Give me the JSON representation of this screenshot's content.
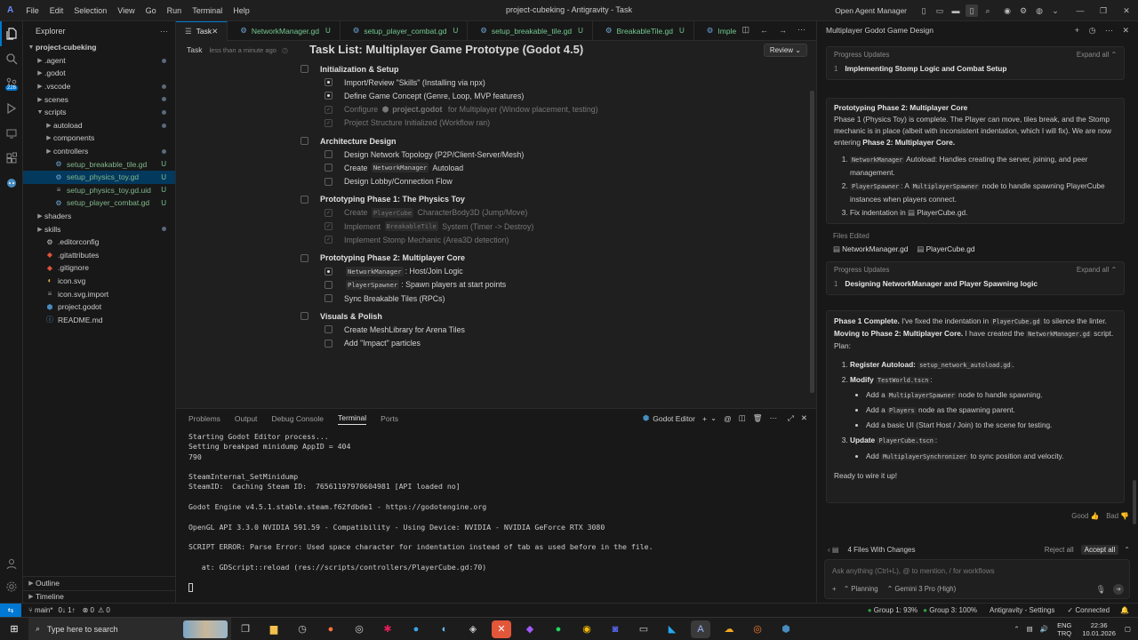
{
  "titlebar": {
    "menus": [
      "File",
      "Edit",
      "Selection",
      "View",
      "Go",
      "Run",
      "Terminal",
      "Help"
    ],
    "title": "project-cubeking - Antigravity - Task",
    "open_agent_manager": "Open Agent Manager"
  },
  "sidebar": {
    "title": "Explorer",
    "root": "project-cubeking",
    "items": [
      {
        "label": ".agent",
        "type": "folder",
        "indent": 1,
        "dot": true
      },
      {
        "label": ".godot",
        "type": "folder",
        "indent": 1,
        "dot": false
      },
      {
        "label": ".vscode",
        "type": "folder",
        "indent": 1,
        "dot": true
      },
      {
        "label": "scenes",
        "type": "folder",
        "indent": 1,
        "dot": true
      },
      {
        "label": "scripts",
        "type": "folder-open",
        "indent": 1,
        "dot": true
      },
      {
        "label": "autoload",
        "type": "folder",
        "indent": 2,
        "dot": true
      },
      {
        "label": "components",
        "type": "folder",
        "indent": 2,
        "dot": false
      },
      {
        "label": "controllers",
        "type": "folder",
        "indent": 2,
        "dot": true
      },
      {
        "label": "setup_breakable_tile.gd",
        "type": "file-gd",
        "indent": 2,
        "status": "U"
      },
      {
        "label": "setup_physics_toy.gd",
        "type": "file-gd",
        "indent": 2,
        "status": "U",
        "selected": true
      },
      {
        "label": "setup_physics_toy.gd.uid",
        "type": "file-uid",
        "indent": 2,
        "status": "U"
      },
      {
        "label": "setup_player_combat.gd",
        "type": "file-gd",
        "indent": 2,
        "status": "U"
      },
      {
        "label": "shaders",
        "type": "folder",
        "indent": 1,
        "dot": false
      },
      {
        "label": "skills",
        "type": "folder",
        "indent": 1,
        "dot": true
      },
      {
        "label": ".editorconfig",
        "type": "file-gear",
        "indent": 1
      },
      {
        "label": ".gitattributes",
        "type": "file-git",
        "indent": 1
      },
      {
        "label": ".gitignore",
        "type": "file-git",
        "indent": 1
      },
      {
        "label": "icon.svg",
        "type": "file-svg",
        "indent": 1
      },
      {
        "label": "icon.svg.import",
        "type": "file-import",
        "indent": 1
      },
      {
        "label": "project.godot",
        "type": "file-godot",
        "indent": 1
      },
      {
        "label": "README.md",
        "type": "file-md",
        "indent": 1
      }
    ],
    "outline": "Outline",
    "timeline": "Timeline"
  },
  "tabs": [
    {
      "label": "Task",
      "active": true,
      "close": "✕"
    },
    {
      "label": "NetworkManager.gd",
      "status": "U"
    },
    {
      "label": "setup_player_combat.gd",
      "status": "U"
    },
    {
      "label": "setup_breakable_tile.gd",
      "status": "U"
    },
    {
      "label": "BreakableTile.gd",
      "status": "U"
    },
    {
      "label": "Imple"
    }
  ],
  "editor": {
    "header": "Task",
    "timestamp": "less than a minute ago",
    "review": "Review",
    "doc_title": "Task List: Multiplayer Game Prototype (Godot 4.5)",
    "sections": [
      {
        "title": "Initialization & Setup",
        "items": [
          {
            "text": "Import/Review \"Skills\" (Installing via npx)",
            "state": "progress"
          },
          {
            "text": "Define Game Concept (Genre, Loop, MVP features)",
            "state": "progress"
          },
          {
            "pre": "Configure ",
            "code": "project.godot",
            "post": " for Multiplayer (Window placement, testing)",
            "state": "done",
            "icon": true
          },
          {
            "text": "Project Structure Initialized (Workflow ran)",
            "state": "done"
          }
        ]
      },
      {
        "title": "Architecture Design",
        "items": [
          {
            "text": "Design Network Topology (P2P/Client-Server/Mesh)",
            "state": "todo"
          },
          {
            "pre": "Create ",
            "code": "NetworkManager",
            "post": " Autoload",
            "state": "todo"
          },
          {
            "text": "Design Lobby/Connection Flow",
            "state": "todo"
          }
        ]
      },
      {
        "title": "Prototyping Phase 1: The Physics Toy",
        "items": [
          {
            "pre": "Create ",
            "code": "PlayerCube",
            "post": " CharacterBody3D (Jump/Move)",
            "state": "done"
          },
          {
            "pre": "Implement ",
            "code": "BreakableTile",
            "post": " System (Timer -> Destroy)",
            "state": "done"
          },
          {
            "text": "Implement Stomp Mechanic (Area3D detection)",
            "state": "done"
          }
        ]
      },
      {
        "title": "Prototyping Phase 2: Multiplayer Core",
        "items": [
          {
            "pre": "",
            "code": "NetworkManager",
            "post": ": Host/Join Logic",
            "state": "progress"
          },
          {
            "pre": "",
            "code": "PlayerSpawner",
            "post": ": Spawn players at start points",
            "state": "todo"
          },
          {
            "text": "Sync Breakable Tiles (RPCs)",
            "state": "todo"
          }
        ]
      },
      {
        "title": "Visuals & Polish",
        "items": [
          {
            "text": "Create MeshLibrary for Arena Tiles",
            "state": "todo"
          },
          {
            "text": "Add \"Impact\" particles",
            "state": "todo"
          }
        ]
      }
    ]
  },
  "panel": {
    "tabs": [
      "Problems",
      "Output",
      "Debug Console",
      "Terminal",
      "Ports"
    ],
    "active_tab": "Terminal",
    "terminal_name": "Godot Editor",
    "lines": [
      "Starting Godot Editor process...",
      "Setting breakpad minidump AppID = 404",
      "790",
      "",
      "SteamInternal_SetMinidump",
      "SteamID:  Caching Steam ID:  76561197970604981 [API loaded no]",
      "",
      "Godot Engine v4.5.1.stable.steam.f62fdbde1 - https://godotengine.org",
      "",
      "OpenGL API 3.3.0 NVIDIA 591.59 - Compatibility - Using Device: NVIDIA - NVIDIA GeForce RTX 3080",
      "",
      "SCRIPT ERROR: Parse Error: Used space character for indentation instead of tab as used before in the file.",
      "",
      "   at: GDScript::reload (res://scripts/controllers/PlayerCube.gd:70)"
    ]
  },
  "agent": {
    "title": "Multiplayer Godot Game Design",
    "progress1_label": "Progress Updates",
    "expand_all": "Expand all",
    "progress1_num": "1",
    "progress1_text": "Implementing Stomp Logic and Combat Setup",
    "msg1_title": "Prototyping Phase 2: Multiplayer Core",
    "msg1_p": "Phase 1 (Physics Toy) is complete. The Player can move, tiles break, and the Stomp mechanic is in place (albeit with inconsistent indentation, which I will fix). We are now entering",
    "msg1_p_bold": "Phase 2: Multiplayer Core.",
    "msg1_list": [
      {
        "code": "NetworkManager",
        "text": " Autoload: Handles creating the server, joining, and peer management."
      },
      {
        "code": "PlayerSpawner",
        "mid": ": A ",
        "code2": "MultiplayerSpawner",
        "text": " node to handle spawning PlayerCube instances when players connect."
      },
      {
        "pre": "Fix indentation in ",
        "file": "PlayerCube.gd",
        "text": "."
      }
    ],
    "files_edited_label": "Files Edited",
    "files_edited": [
      "NetworkManager.gd",
      "PlayerCube.gd"
    ],
    "progress2_label": "Progress Updates",
    "progress2_num": "1",
    "progress2_text": "Designing NetworkManager and Player Spawning logic",
    "msg2": {
      "b1": "Phase 1 Complete.",
      "t1": " I've fixed the indentation in ",
      "c1": "PlayerCube.gd",
      "t2": " to silence the linter.",
      "b2": "Moving to Phase 2: Multiplayer Core.",
      "t3": " I have created the ",
      "c2": "NetworkManager.gd",
      "t4": " script. Plan:",
      "s1_b": "Register Autoload:",
      "s1_c": "setup_network_autoload.gd",
      "s2_b": "Modify",
      "s2_c": "TestWorld.tscn",
      "s2_items": [
        {
          "pre": "Add a ",
          "code": "MultiplayerSpawner",
          "post": " node to handle spawning."
        },
        {
          "pre": "Add a ",
          "code": "Players",
          "post": " node as the spawning parent."
        },
        {
          "pre": "Add a basic UI (Start Host / Join) to the scene for testing.",
          "code": "",
          "post": ""
        }
      ],
      "s3_b": "Update",
      "s3_c": "PlayerCube.tscn",
      "s3_items": [
        {
          "pre": "Add ",
          "code": "MultiplayerSynchronizer",
          "post": " to sync position and velocity."
        }
      ],
      "end": "Ready to wire it up!"
    },
    "good": "Good",
    "bad": "Bad",
    "changes": "4 Files With Changes",
    "reject_all": "Reject all",
    "accept_all": "Accept all",
    "input_placeholder": "Ask anything (Ctrl+L), @ to mention, / for workflows",
    "mode": "Planning",
    "model": "Gemini 3 Pro (High)"
  },
  "status": {
    "branch": "main*",
    "sync": "0↓ 1↑",
    "errors": "⊗ 0",
    "warnings": "⚠ 0",
    "group1": "Group 1: 93%",
    "group3": "Group 3: 100%",
    "settings": "Antigravity - Settings",
    "connected": "Connected"
  },
  "taskbar": {
    "search": "Type here to search",
    "lang1": "ENG",
    "lang2": "TRQ",
    "time": "22:36",
    "date": "10.01.2026"
  },
  "colors": {
    "accent": "#0078d4",
    "untracked": "#73c991",
    "status_green": "#2ea043"
  }
}
